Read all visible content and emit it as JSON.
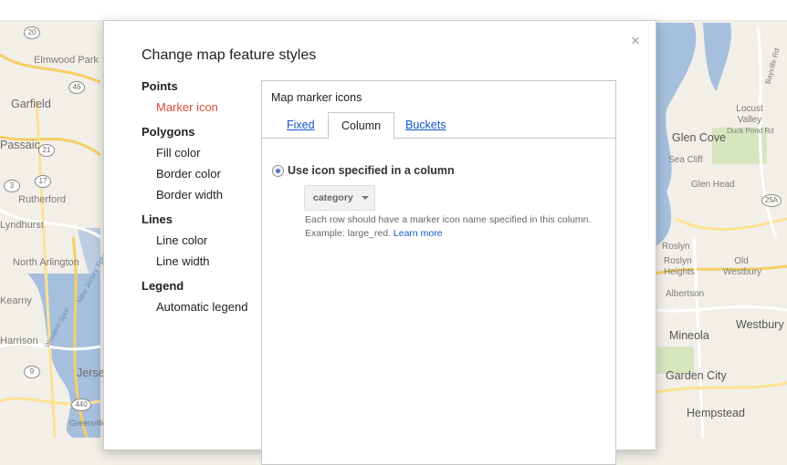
{
  "map": {
    "labels": [
      "Elmwood Park",
      "Garfield",
      "Passaic",
      "Rutherford",
      "Lyndhurst",
      "North Arlington",
      "Kearny",
      "Harrison",
      "Jersey",
      "Greenville",
      "New Jersey Tpke",
      "Western Spur",
      "Locust Valley",
      "Duck Pond Rd",
      "Glen Cove",
      "Sea Cliff",
      "Glen Head",
      "Roslyn",
      "Roslyn Heights",
      "Old Westbury",
      "Albertson",
      "Mineola",
      "Westbury",
      "Garden City",
      "Hempstead",
      "Bayville Rd"
    ],
    "shields": [
      "20",
      "46",
      "21",
      "3",
      "17",
      "9",
      "440",
      "25A"
    ]
  },
  "dialog": {
    "title": "Change map feature styles",
    "close_label": "×",
    "sidebar": {
      "points": {
        "heading": "Points",
        "items": [
          "Marker icon"
        ]
      },
      "polygons": {
        "heading": "Polygons",
        "items": [
          "Fill color",
          "Border color",
          "Border width"
        ]
      },
      "lines": {
        "heading": "Lines",
        "items": [
          "Line color",
          "Line width"
        ]
      },
      "legend": {
        "heading": "Legend",
        "items": [
          "Automatic legend"
        ]
      }
    },
    "panel": {
      "title": "Map marker icons",
      "tabs": [
        "Fixed",
        "Column",
        "Buckets"
      ],
      "selected_tab": "Column",
      "radio_label": "Use icon specified in a column",
      "select_value": "category",
      "help_line1": "Each row should have a marker icon name specified in this column.",
      "help_line2": "Example: large_red.",
      "learn_more": "Learn more"
    }
  },
  "colors": {
    "accent_active": "#dd4b39",
    "link": "#1155cc",
    "radio_dot": "#4a6fd1"
  }
}
